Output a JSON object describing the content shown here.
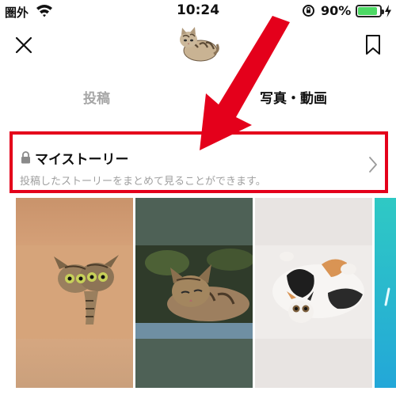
{
  "status_bar": {
    "carrier": "圏外",
    "time": "10:24",
    "battery_percent": "90%",
    "battery_level": 0.9,
    "wifi_icon": "wifi-icon",
    "rotation_lock_icon": "rotation-lock-icon",
    "charging_icon": "bolt-icon"
  },
  "header": {
    "close_icon": "close-icon",
    "avatar_icon": "cat-avatar",
    "bookmark_icon": "bookmark-icon"
  },
  "tabs": [
    {
      "label": "投稿",
      "active": false
    },
    {
      "label": "写真・動画",
      "active": true
    }
  ],
  "my_story": {
    "title": "マイストーリー",
    "description": "投稿したストーリーをまとめて見ることができます。",
    "lock_icon": "lock-icon",
    "chevron_icon": "chevron-right-icon",
    "highlight_color": "#e4001b"
  },
  "photos": [
    {
      "name": "cat-photo-1"
    },
    {
      "name": "cat-photo-2"
    },
    {
      "name": "cat-photo-3"
    },
    {
      "name": "partial-tile"
    }
  ],
  "colors": {
    "accent_red": "#e4001b",
    "inactive_tab": "#a6a6a6",
    "battery_green": "#4cd964"
  }
}
